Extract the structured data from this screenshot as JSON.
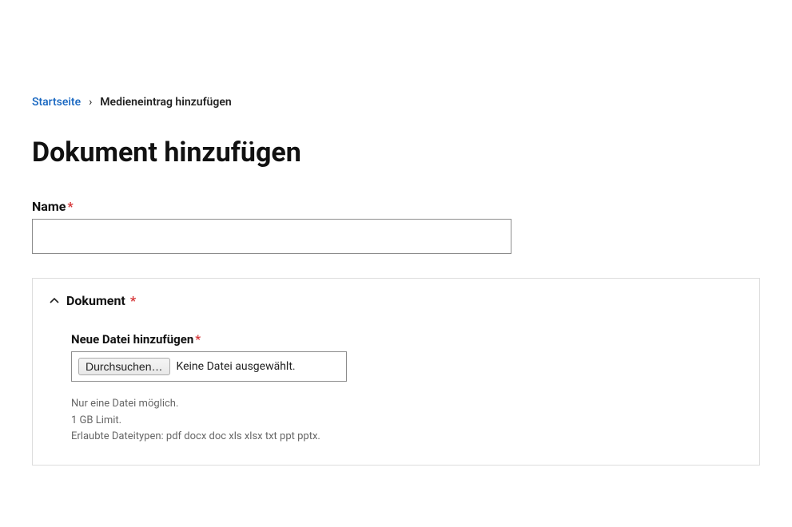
{
  "breadcrumb": {
    "home": "Startseite",
    "current": "Medieneintrag hinzufügen"
  },
  "page_title": "Dokument hinzufügen",
  "name_field": {
    "label": "Name",
    "value": ""
  },
  "dokument_fieldset": {
    "title": "Dokument",
    "file_field": {
      "label": "Neue Datei hinzufügen",
      "browse_label": "Durchsuchen…",
      "status": "Keine Datei ausgewählt.",
      "hints": {
        "limit_files": "Nur eine Datei möglich.",
        "limit_size": "1 GB Limit.",
        "allowed_types": "Erlaubte Dateitypen: pdf docx doc xls xlsx txt ppt pptx."
      }
    }
  }
}
